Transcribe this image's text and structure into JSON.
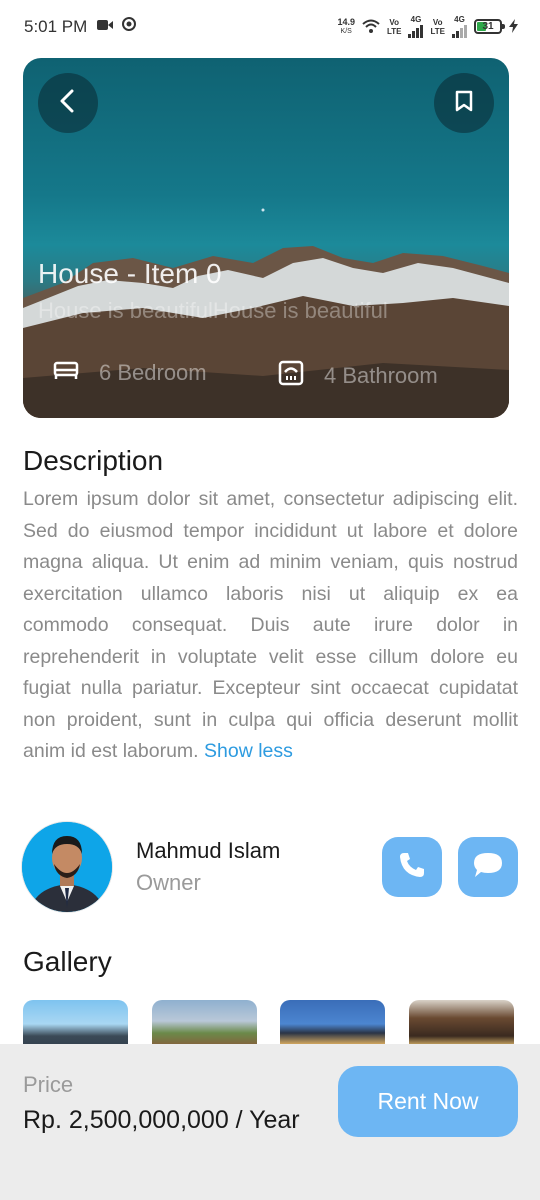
{
  "status_bar": {
    "time": "5:01 PM",
    "net_rate": "14.9",
    "net_rate_unit": "K/S",
    "volte1_top": "Vo",
    "volte1_bottom": "LTE",
    "net1": "4G",
    "volte2_top": "Vo",
    "volte2_bottom": "LTE",
    "net2": "4G",
    "battery": "31",
    "icons": [
      "video-camera-icon",
      "notification-circle-icon",
      "wifi-icon",
      "signal-icon",
      "battery-icon",
      "charging-bolt-icon"
    ]
  },
  "hero": {
    "title": "House - Item 0",
    "subtitle": "House is beautifulHouse is beautiful",
    "bedrooms": "6 Bedroom",
    "bathrooms": "4 Bathroom",
    "icons": [
      "back-arrow-icon",
      "bookmark-icon",
      "bed-icon",
      "bathroom-icon"
    ]
  },
  "description": {
    "heading": "Description",
    "text": "Lorem ipsum dolor sit amet, consectetur adipiscing elit. Sed do eiusmod tempor incididunt ut labore et dolore magna aliqua. Ut enim ad minim veniam, quis nostrud exercitation ullamco laboris nisi ut aliquip ex ea commodo consequat. Duis aute irure dolor in reprehenderit in voluptate velit esse cillum dolore eu fugiat nulla pariatur. Excepteur sint occaecat cupidatat non proident, sunt in culpa qui officia deserunt mollit anim id est laborum.",
    "toggle_label": "Show less"
  },
  "owner": {
    "name": "Mahmud Islam",
    "role": "Owner",
    "icons": [
      "phone-icon",
      "chat-bubble-icon"
    ]
  },
  "gallery": {
    "heading": "Gallery"
  },
  "footer": {
    "price_label": "Price",
    "price_value": "Rp. 2,500,000,000 / Year",
    "cta_label": "Rent Now"
  },
  "colors": {
    "accent": "#6db6f3",
    "link": "#2d9be0",
    "bottom_bar": "#ececec"
  }
}
